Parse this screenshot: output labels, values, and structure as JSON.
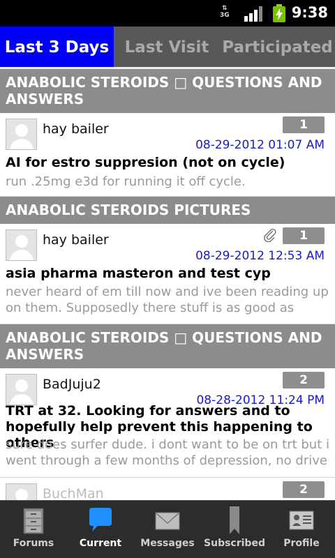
{
  "status_bar": {
    "network": "3G",
    "time": "9:38"
  },
  "tabs": [
    {
      "label": "Last 3 Days",
      "active": true
    },
    {
      "label": "Last Visit",
      "active": false
    },
    {
      "label": "Participated",
      "active": false
    }
  ],
  "sections": [
    {
      "header": "ANABOLIC STEROIDS □ QUESTIONS AND ANSWERS",
      "post": {
        "author": "hay bailer",
        "count": "1",
        "date": "08-29-2012 01:07 AM",
        "title": "AI for estro suppresion (not on cycle)",
        "snippet": "run .25mg e3d for running it off cycle.",
        "has_attachment": false
      }
    },
    {
      "header": "ANABOLIC STEROIDS PICTURES",
      "post": {
        "author": "hay bailer",
        "count": "1",
        "date": "08-29-2012 12:53 AM",
        "title": "asia pharma masteron and test cyp",
        "snippet": "never heard of em till now and ive been reading up on them. Supposedly there stuff is as good as",
        "has_attachment": true
      }
    },
    {
      "header": "ANABOLIC STEROIDS □ QUESTIONS AND ANSWERS",
      "post": {
        "author": "BadJuju2",
        "count": "2",
        "date": "08-28-2012 11:24 PM",
        "title": "TRT at 32. Looking for answers and to hopefully help prevent this happening to others",
        "snippet": "sure does surfer dude. i dont want to be on trt but i went through a few months of depression, no drive",
        "has_attachment": false
      }
    },
    {
      "post": {
        "author": "BuchMan",
        "count": "2"
      }
    }
  ],
  "bottom_nav": [
    {
      "label": "Forums",
      "icon": "cabinet-icon",
      "active": false
    },
    {
      "label": "Current",
      "icon": "chat-bubble-icon",
      "active": true
    },
    {
      "label": "Messages",
      "icon": "envelope-icon",
      "active": false
    },
    {
      "label": "Subscribed",
      "icon": "bookmark-icon",
      "active": false
    },
    {
      "label": "Profile",
      "icon": "profile-card-icon",
      "active": false
    }
  ],
  "colors": {
    "active_tab": "#0000f6",
    "section_header": "#8c8c8c",
    "date_text": "#1a1ac8",
    "active_nav_icon": "#1e90ff"
  }
}
